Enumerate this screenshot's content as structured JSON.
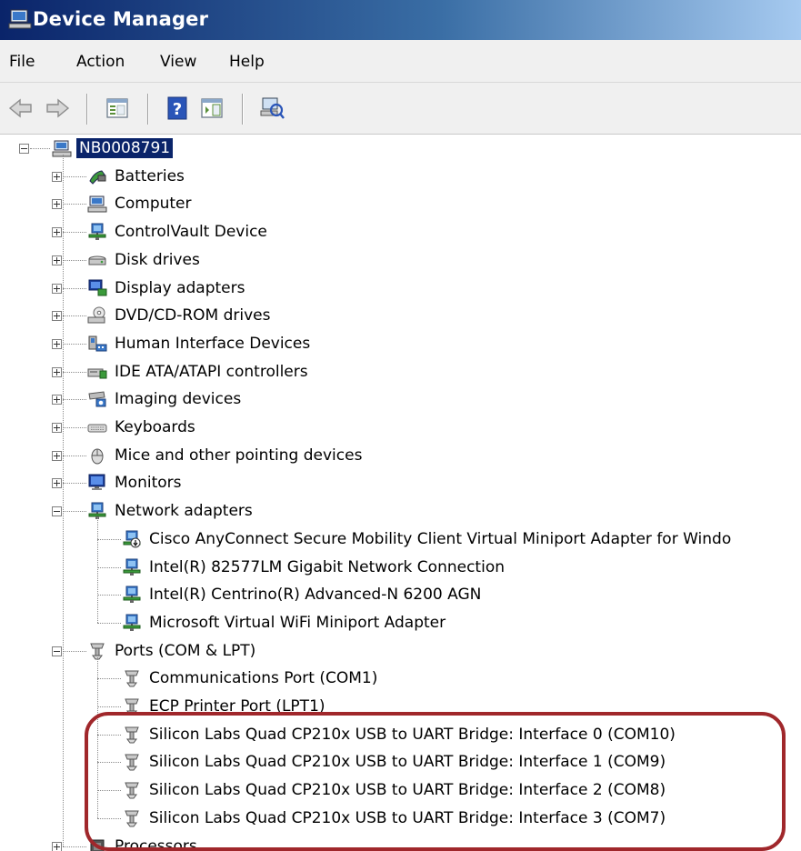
{
  "window": {
    "title": "Device Manager"
  },
  "menu": [
    "File",
    "Action",
    "View",
    "Help"
  ],
  "toolbar": {
    "buttons": [
      {
        "name": "back-arrow-icon"
      },
      {
        "name": "forward-arrow-icon"
      },
      {
        "name": "properties-icon"
      },
      {
        "name": "help-icon"
      },
      {
        "name": "show-hide-console-tree-icon"
      },
      {
        "name": "scan-hardware-changes-icon"
      }
    ]
  },
  "tree": {
    "root": {
      "label": "NB0008791",
      "expanded": true,
      "icon": "computer-icon"
    },
    "categories": [
      {
        "label": "Batteries",
        "icon": "battery-icon",
        "expanded": false
      },
      {
        "label": "Computer",
        "icon": "computer-icon",
        "expanded": false
      },
      {
        "label": "ControlVault Device",
        "icon": "device-icon",
        "expanded": false
      },
      {
        "label": "Disk drives",
        "icon": "disk-drive-icon",
        "expanded": false
      },
      {
        "label": "Display adapters",
        "icon": "display-adapter-icon",
        "expanded": false
      },
      {
        "label": "DVD/CD-ROM drives",
        "icon": "dvd-drive-icon",
        "expanded": false
      },
      {
        "label": "Human Interface Devices",
        "icon": "hid-icon",
        "expanded": false
      },
      {
        "label": "IDE ATA/ATAPI controllers",
        "icon": "ide-controller-icon",
        "expanded": false
      },
      {
        "label": "Imaging devices",
        "icon": "camera-icon",
        "expanded": false
      },
      {
        "label": "Keyboards",
        "icon": "keyboard-icon",
        "expanded": false
      },
      {
        "label": "Mice and other pointing devices",
        "icon": "mouse-icon",
        "expanded": false
      },
      {
        "label": "Monitors",
        "icon": "monitor-icon",
        "expanded": false
      },
      {
        "label": "Network adapters",
        "icon": "network-adapter-icon",
        "expanded": true,
        "children": [
          {
            "label": "Cisco AnyConnect Secure Mobility Client Virtual Miniport Adapter for Windo",
            "icon": "network-adapter-disabled-icon"
          },
          {
            "label": "Intel(R) 82577LM Gigabit Network Connection",
            "icon": "network-adapter-icon"
          },
          {
            "label": "Intel(R) Centrino(R) Advanced-N 6200 AGN",
            "icon": "network-adapter-icon"
          },
          {
            "label": "Microsoft Virtual WiFi Miniport Adapter",
            "icon": "network-adapter-icon"
          }
        ]
      },
      {
        "label": "Ports (COM & LPT)",
        "icon": "port-icon",
        "expanded": true,
        "children": [
          {
            "label": "Communications Port (COM1)",
            "icon": "port-icon"
          },
          {
            "label": "ECP Printer Port (LPT1)",
            "icon": "port-icon"
          },
          {
            "label": "Silicon Labs Quad CP210x USB to UART Bridge: Interface 0 (COM10)",
            "icon": "port-icon"
          },
          {
            "label": "Silicon Labs Quad CP210x USB to UART Bridge: Interface 1 (COM9)",
            "icon": "port-icon"
          },
          {
            "label": "Silicon Labs Quad CP210x USB to UART Bridge: Interface 2 (COM8)",
            "icon": "port-icon"
          },
          {
            "label": "Silicon Labs Quad CP210x USB to UART Bridge: Interface 3 (COM7)",
            "icon": "port-icon"
          }
        ]
      },
      {
        "label": "Processors",
        "icon": "processor-icon",
        "expanded": false
      }
    ]
  },
  "colors": {
    "title_gradient_start": "#0a246a",
    "selection": "#0a246a",
    "highlight_outline": "#a0272b",
    "chrome": "#f0f0f0"
  }
}
